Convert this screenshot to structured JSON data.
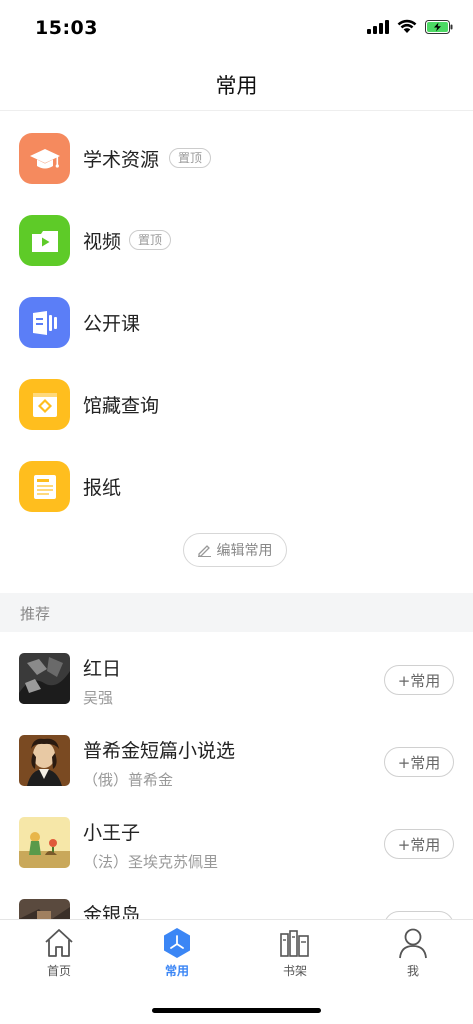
{
  "status_bar": {
    "time": "15:03"
  },
  "header": {
    "title": "常用"
  },
  "favorites": [
    {
      "label": "学术资源",
      "badge": "置顶",
      "icon": "graduation-cap-icon",
      "color": "#f58a5e"
    },
    {
      "label": "视频",
      "badge": "置顶",
      "icon": "video-play-icon",
      "color": "#5ecb28"
    },
    {
      "label": "公开课",
      "badge": "",
      "icon": "open-course-icon",
      "color": "#5b7ef7"
    },
    {
      "label": "馆藏查询",
      "badge": "",
      "icon": "library-catalog-icon",
      "color": "#ffbe1e"
    },
    {
      "label": "报纸",
      "badge": "",
      "icon": "newspaper-icon",
      "color": "#ffbe1e"
    }
  ],
  "edit_button": {
    "label": "编辑常用"
  },
  "recommend": {
    "title": "推荐",
    "items": [
      {
        "title": "红日",
        "author": "吴强",
        "action": "+常用"
      },
      {
        "title": "普希金短篇小说选",
        "author": "（俄）普希金",
        "action": "+常用"
      },
      {
        "title": "小王子",
        "author": "（法）圣埃克苏佩里",
        "action": "+常用"
      },
      {
        "title": "金银岛",
        "author": "",
        "action": "+常用"
      }
    ]
  },
  "tabbar": {
    "tabs": [
      {
        "label": "首页",
        "icon": "home-icon"
      },
      {
        "label": "常用",
        "icon": "hexagon-icon",
        "active": true
      },
      {
        "label": "书架",
        "icon": "bookshelf-icon"
      },
      {
        "label": "我",
        "icon": "person-icon"
      }
    ]
  },
  "colors": {
    "accent": "#3b86f5"
  }
}
